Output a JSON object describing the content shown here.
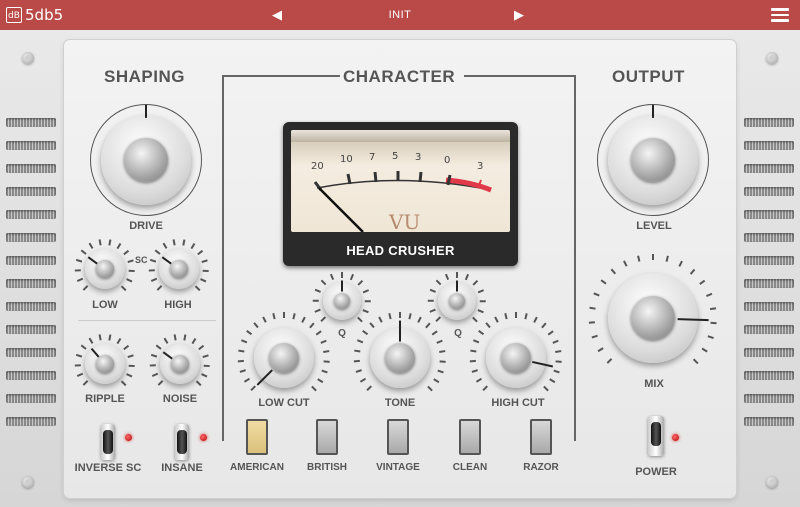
{
  "app": {
    "logo_badge": "dB",
    "name": "5db5"
  },
  "preset": {
    "name": "INIT",
    "prev_icon": "triangle-left",
    "next_icon": "triangle-right"
  },
  "menu": {
    "icon": "hamburger-menu"
  },
  "sections": {
    "shaping": "SHAPING",
    "character": "CHARACTER",
    "output": "OUTPUT"
  },
  "shaping": {
    "drive": "DRIVE",
    "sc": "SC",
    "low": "LOW",
    "high": "HIGH",
    "ripple": "RIPPLE",
    "noise": "NOISE",
    "inverse_sc": "INVERSE SC",
    "insane": "INSANE"
  },
  "meter": {
    "scale": [
      "20",
      "10",
      "7",
      "5",
      "3",
      "0",
      "3"
    ],
    "vu": "VU",
    "name": "HEAD CRUSHER"
  },
  "character": {
    "q_left": "Q",
    "q_right": "Q",
    "low_cut": "LOW CUT",
    "tone": "TONE",
    "high_cut": "HIGH CUT",
    "modes": [
      "AMERICAN",
      "BRITISH",
      "VINTAGE",
      "CLEAN",
      "RAZOR"
    ],
    "active_mode": "AMERICAN"
  },
  "output": {
    "level": "LEVEL",
    "mix": "MIX",
    "power": "POWER"
  },
  "colors": {
    "topbar": "#b94a47",
    "active_mode": "#e8cf8c",
    "led": "#d00000"
  }
}
